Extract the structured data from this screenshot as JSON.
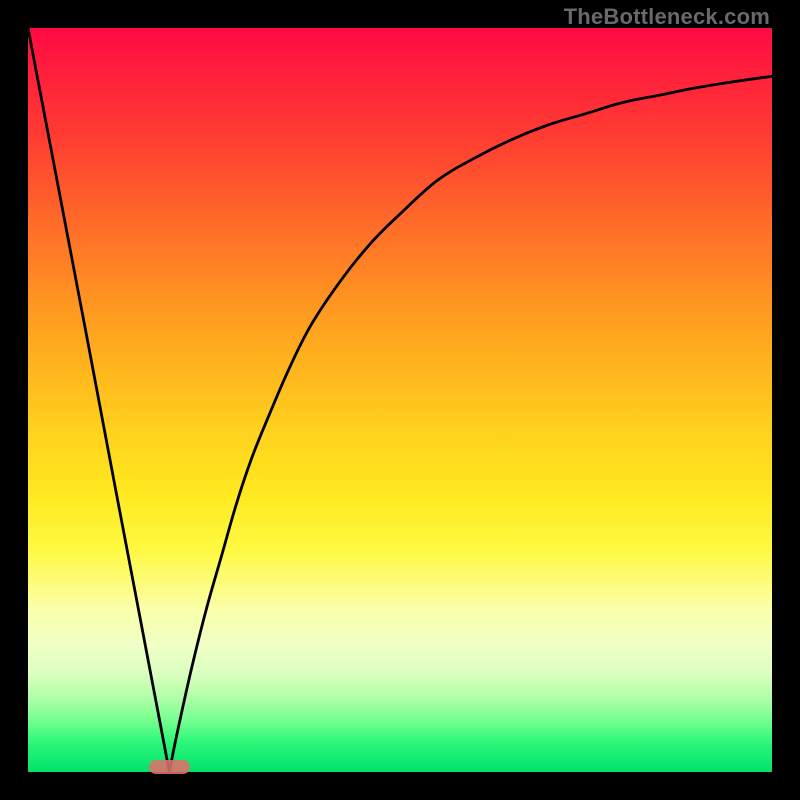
{
  "watermark_text": "TheBottleneck.com",
  "chart_data": {
    "type": "line",
    "title": "",
    "xlabel": "",
    "ylabel": "",
    "xlim": [
      0,
      100
    ],
    "ylim": [
      0,
      100
    ],
    "x": [
      0,
      2,
      4,
      6,
      8,
      10,
      12,
      14,
      16,
      18,
      20,
      22,
      24,
      26,
      28,
      30,
      32,
      35,
      38,
      42,
      46,
      50,
      55,
      60,
      65,
      70,
      75,
      80,
      85,
      90,
      95,
      100
    ],
    "series": [
      {
        "name": "left-branch",
        "description": "Steep descending line from top-left into the minimum",
        "x": [
          0,
          2,
          4,
          6,
          8,
          10,
          12,
          14,
          16,
          18,
          19
        ],
        "values": [
          100,
          89.5,
          79,
          68.5,
          58,
          47.4,
          36.8,
          26.3,
          15.8,
          5.3,
          0
        ]
      },
      {
        "name": "right-branch",
        "description": "Rising concave curve from minimum toward upper right",
        "x": [
          19,
          20,
          22,
          24,
          26,
          28,
          30,
          32,
          35,
          38,
          42,
          46,
          50,
          55,
          60,
          65,
          70,
          75,
          80,
          85,
          90,
          95,
          100
        ],
        "values": [
          0,
          5,
          14,
          22,
          29,
          36,
          42,
          47,
          54,
          60,
          66,
          71,
          75,
          79.5,
          82.5,
          85,
          87,
          88.5,
          90,
          91,
          92,
          92.8,
          93.5
        ]
      }
    ],
    "marker": {
      "name": "minimum-marker",
      "x_center": 19,
      "y": 0,
      "width_x_units": 5.6,
      "color": "#e06f6c"
    },
    "background_gradient": {
      "direction": "top-to-bottom",
      "stops": [
        {
          "pos": 0.0,
          "color": "#ff0a44"
        },
        {
          "pos": 0.3,
          "color": "#ff7a26"
        },
        {
          "pos": 0.62,
          "color": "#ffe71f"
        },
        {
          "pos": 0.83,
          "color": "#f0ffc6"
        },
        {
          "pos": 1.0,
          "color": "#00e26a"
        }
      ]
    }
  }
}
